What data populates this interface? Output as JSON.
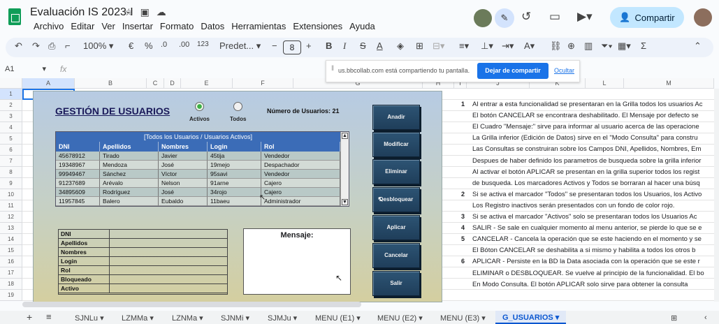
{
  "title_bar": {
    "doc_title": "Evaluación IS 2023-I",
    "menus": [
      "Archivo",
      "Editar",
      "Ver",
      "Insertar",
      "Formato",
      "Datos",
      "Herramientas",
      "Extensiones",
      "Ayuda"
    ],
    "share_label": "Compartir"
  },
  "toolbar": {
    "zoom": "100%",
    "currency": "€",
    "percent": "%",
    "dec_less": ".0",
    "dec_more": ".00",
    "number_format": "123",
    "font": "Predet...",
    "font_size": "8",
    "minus": "−",
    "plus": "+",
    "bold": "B",
    "italic": "I",
    "strike": "S",
    "text_color": "A",
    "sigma": "Σ"
  },
  "formula_bar": {
    "cell_ref": "A1",
    "fx": "fx"
  },
  "share_banner": {
    "text": "us.bbcollab.com está compartiendo tu pantalla.",
    "stop_label": "Dejar de compartir",
    "hide_label": "Ocultar"
  },
  "columns": [
    "A",
    "B",
    "C",
    "D",
    "E",
    "F",
    "G",
    "H",
    "I",
    "J",
    "K",
    "L",
    "M"
  ],
  "rows": [
    "1",
    "2",
    "3",
    "4",
    "5",
    "6",
    "7",
    "8",
    "9",
    "10",
    "11",
    "12",
    "13",
    "14",
    "15",
    "16",
    "17",
    "18",
    "19"
  ],
  "form": {
    "title": "GESTIÓN DE USUARIOS",
    "radio_active": "Activos",
    "radio_all": "Todos",
    "user_count": "Número de Usuarios: 21",
    "grid_title": "[Todos los Usuarios / Usuarios Activos]",
    "grid_headers": [
      "DNI",
      "Apellidos",
      "Nombres",
      "Login",
      "Rol"
    ],
    "grid_rows": [
      [
        "45678912",
        "Tirado",
        "Javier",
        "45tija",
        "Vendedor"
      ],
      [
        "19348967",
        "Mendoza",
        "José",
        "19mejo",
        "Despachador"
      ],
      [
        "99949467",
        "Sánchez",
        "Víctor",
        "95savi",
        "Vendedor"
      ],
      [
        "91237689",
        "Arévalo",
        "Nelson",
        "91arne",
        "Cajero"
      ],
      [
        "34895609",
        "Rodríguez",
        "José",
        "34rojo",
        "Cajero"
      ],
      [
        "11957845",
        "Balero",
        "Eubaldo",
        "11baeu",
        "Administrador"
      ]
    ],
    "detail_labels": [
      "DNI",
      "Apellidos",
      "Nombres",
      "Login",
      "Rol",
      "Bloqueado",
      "Activo"
    ],
    "message_label": "Mensaje:",
    "buttons": [
      "Anadir",
      "Modificar",
      "Eliminar",
      "Desbloquear",
      "Aplicar",
      "Cancelar",
      "Salir"
    ]
  },
  "notes": [
    {
      "num": "1",
      "text": "Al entrar a esta funcionalidad se presentaran en la Grilla todos los usuarios Ac"
    },
    {
      "num": "",
      "text": "El botón CANCELAR se encontrara deshabilitado. El Mensaje por defecto se"
    },
    {
      "num": "",
      "text": "El Cuadro \"Mensaje:\" sirve para informar al usuario acerca de las operacione"
    },
    {
      "num": "",
      "text": "La Grilla inferior (Edición de Datos) sirve en el \"Modo Consulta\" para constru"
    },
    {
      "num": "",
      "text": "Las Consultas se construiran sobre los Campos DNI, Apellidos, Nombres, Em"
    },
    {
      "num": "",
      "text": "Despues de haber definido los parametros de busqueda sobre la grilla inferior"
    },
    {
      "num": "",
      "text": "Al activar el botón APLICAR se presentan en la grilla superior todos los regist"
    },
    {
      "num": "",
      "text": "de busqueda. Los marcadores Activos y Todos se borraran al hacer una búsq"
    },
    {
      "num": "2",
      "text": "Si se activa el marcador \"Todos\" se presentaran todos los Usuarios, los Activo"
    },
    {
      "num": "",
      "text": "Los Registro inactivos serán presentados con un fondo de color rojo."
    },
    {
      "num": "3",
      "text": "Si se activa el marcador \"Activos\" solo se presentaran todos los Usuarios  Ac"
    },
    {
      "num": "4",
      "text": "SALIR - Se sale en cualquier momento al menu anterior, se pierde lo que se e"
    },
    {
      "num": "5",
      "text": "CANCELAR - Cancela la operación que se este haciendo en el momento y se"
    },
    {
      "num": "",
      "text": "El Bóton CANCELAR  se deshabilita a si mismo  y habilita a  todos los otros b"
    },
    {
      "num": "6",
      "text": "APLICAR - Persiste en la BD la Data asociada con la operación que se este r"
    },
    {
      "num": "",
      "text": "ELIMINAR o DESBLOQUEAR.  Se vuelve al principio de la funcionalidad. El bo"
    },
    {
      "num": "",
      "text": "En Modo Consulta. El botón APLICAR solo sirve para obtener la consulta"
    }
  ],
  "sheet_tabs": [
    "SJNLu",
    "LZMMa",
    "LZNMa",
    "SJNMi",
    "SJMJu",
    "MENU (E1)",
    "MENU (E2)",
    "MENU (E3)",
    "G_USUARIOS"
  ],
  "colors": {
    "accent": "#0b57d0",
    "grid_header": "#3b6cb7",
    "button": "#2d5474"
  }
}
